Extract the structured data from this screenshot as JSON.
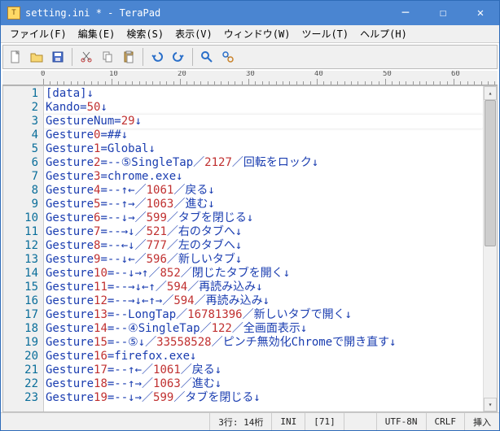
{
  "window": {
    "title": "setting.ini * - TeraPad"
  },
  "menu": {
    "file": "ファイル(F)",
    "edit": "編集(E)",
    "search": "検索(S)",
    "view": "表示(V)",
    "window": "ウィンドウ(W)",
    "tools": "ツール(T)",
    "help": "ヘルプ(H)"
  },
  "toolbar": {
    "new": "new-file",
    "open": "open-file",
    "save": "save-file",
    "cut": "cut",
    "copy": "copy",
    "paste": "paste",
    "undo": "undo",
    "redo": "redo",
    "find": "find",
    "replace": "replace"
  },
  "ruler": {
    "ticks": [
      0,
      10,
      20,
      30,
      40,
      50,
      60
    ]
  },
  "gutter_start": 1,
  "lines": [
    "[data]↓",
    "Kando=50↓",
    "GestureNum=29↓",
    "Gesture0=##↓",
    "Gesture1=Global↓",
    "Gesture2=--⑤SingleTap／2127／回転をロック↓",
    "Gesture3=chrome.exe↓",
    "Gesture4=--↑←／1061／戻る↓",
    "Gesture5=--↑→／1063／進む↓",
    "Gesture6=--↓→／599／タブを閉じる↓",
    "Gesture7=--→↓／521／右のタブへ↓",
    "Gesture8=--←↓／777／左のタブへ↓",
    "Gesture9=--↓←／596／新しいタブ↓",
    "Gesture10=--↓→↑／852／閉じたタブを開く↓",
    "Gesture11=--→↓←↑／594／再読み込み↓",
    "Gesture12=--→↓←↑→／594／再読み込み↓",
    "Gesture13=--LongTap／16781396／新しいタブで開く↓",
    "Gesture14=--④SingleTap／122／全画面表示↓",
    "Gesture15=--⑤↓／33558528／ピンチ無効化Chromeで開き直す↓",
    "Gesture16=firefox.exe↓",
    "Gesture17=--↑←／1061／戻る↓",
    "Gesture18=--↑→／1063／進む↓",
    "Gesture19=--↓→／599／タブを閉じる↓"
  ],
  "highlight_line_index": 2,
  "status": {
    "pos": "3行: 14桁",
    "mode": "INI",
    "code": "[71]",
    "enc": "UTF-8N",
    "eol": "CRLF",
    "ins": "挿入"
  }
}
